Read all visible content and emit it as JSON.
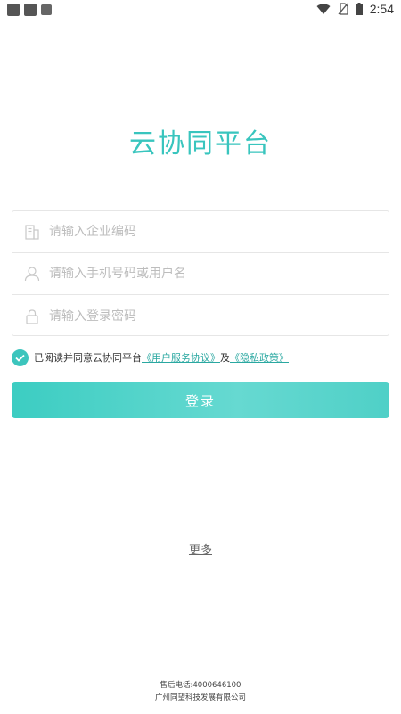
{
  "status_bar": {
    "time": "2:54",
    "icons": [
      "notification-square-icon",
      "notification-square-icon",
      "app-badge-icon",
      "wifi-icon",
      "no-sim-icon",
      "battery-icon"
    ]
  },
  "app": {
    "title": "云协同平台"
  },
  "form": {
    "company_code_placeholder": "请输入企业编码",
    "phone_placeholder": "请输入手机号码或用户名",
    "password_placeholder": "请输入登录密码"
  },
  "agreement": {
    "prefix": "已阅读并同意云协同平台",
    "user_agreement": "《用户服务协议》",
    "and": "及",
    "privacy_policy": "《隐私政策》",
    "checked": true
  },
  "buttons": {
    "login": "登录",
    "more": "更多"
  },
  "footer": {
    "hotline": "售后电话:4000646100",
    "company": "广州同望科技发展有限公司"
  },
  "colors": {
    "accent": "#39c5be",
    "link": "#2aa8a1"
  }
}
